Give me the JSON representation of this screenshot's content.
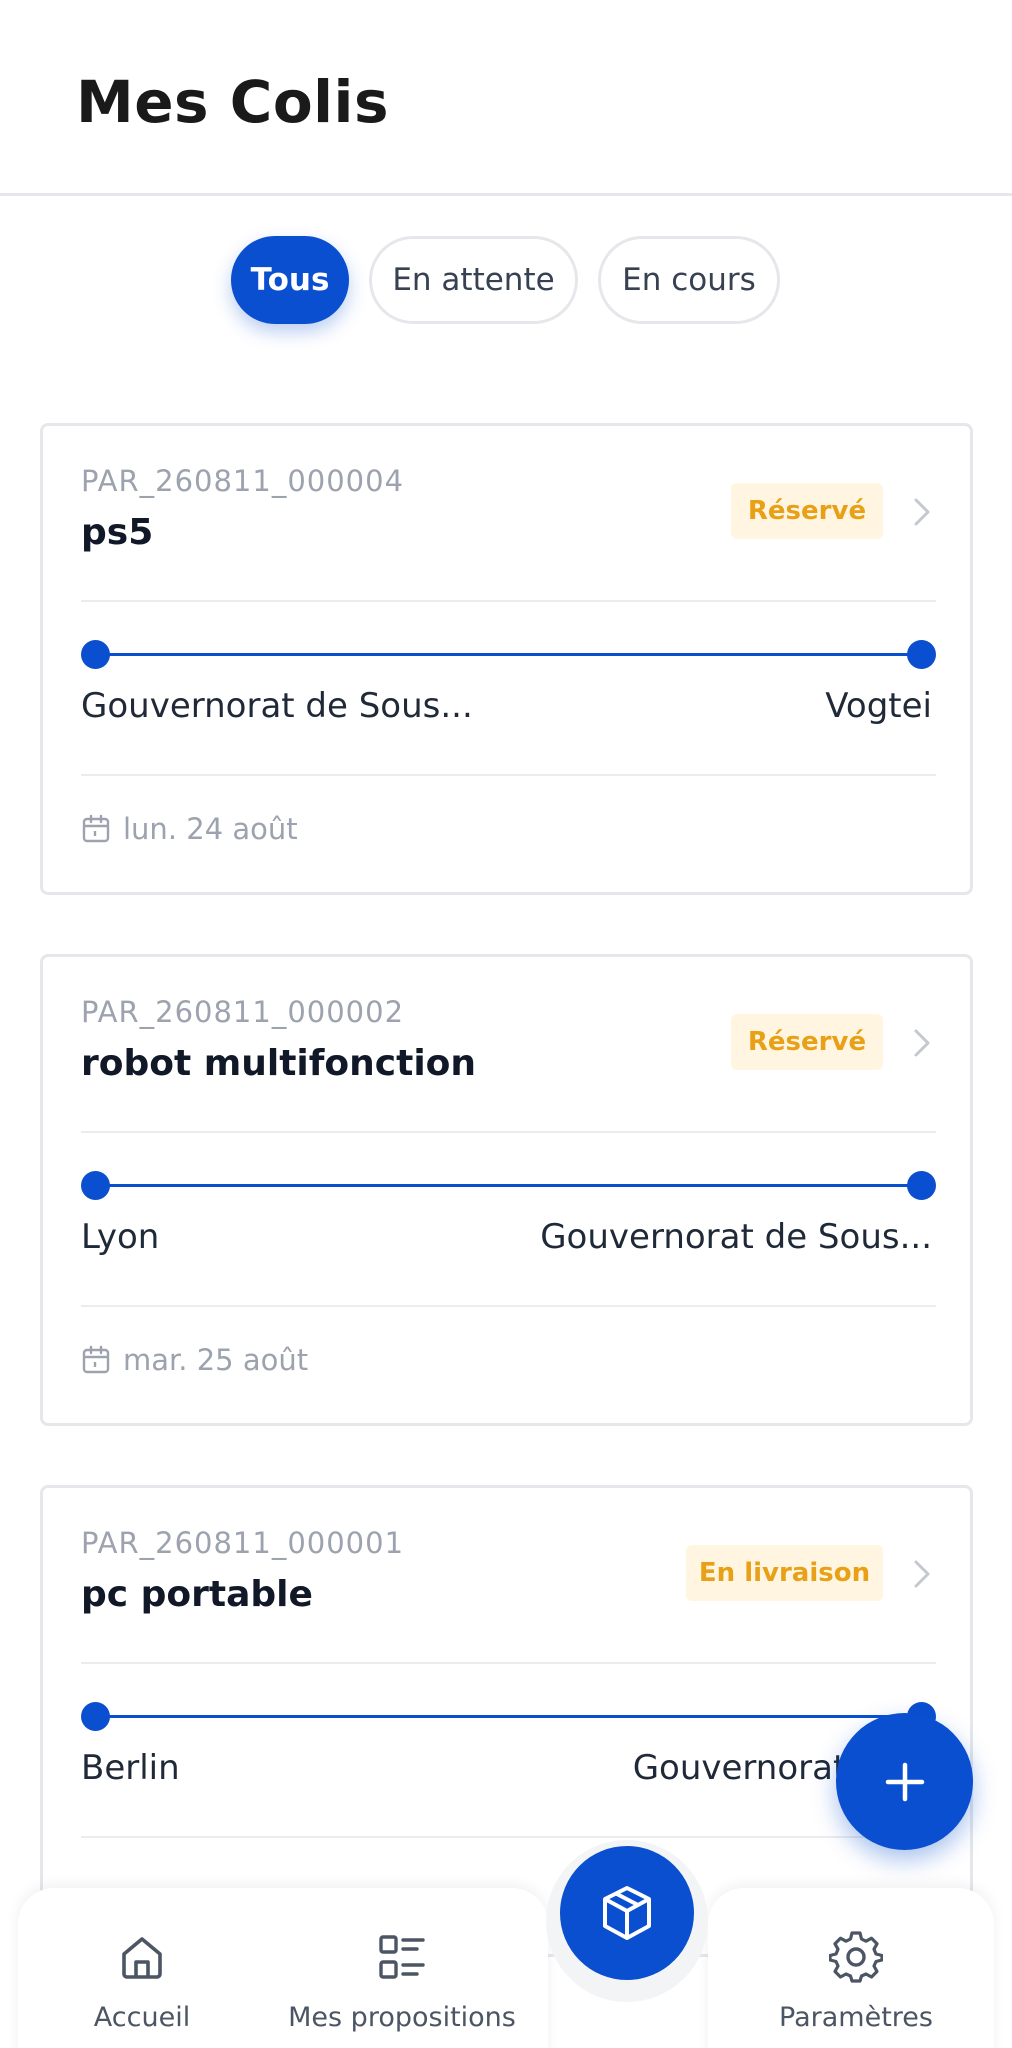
{
  "header": {
    "title": "Mes Colis"
  },
  "filters": [
    {
      "label": "Tous",
      "active": true
    },
    {
      "label": "En attente",
      "active": false
    },
    {
      "label": "En cours",
      "active": false
    }
  ],
  "parcels": [
    {
      "ref": "PAR_260811_000004",
      "name": "ps5",
      "status": "Réservé",
      "from": "Gouvernorat de Sous...",
      "to": "Vogtei",
      "date": "lun. 24 août"
    },
    {
      "ref": "PAR_260811_000002",
      "name": "robot multifonction",
      "status": "Réservé",
      "from": "Lyon",
      "to": "Gouvernorat de Sous...",
      "date": "mar. 25 août"
    },
    {
      "ref": "PAR_260811_000001",
      "name": "pc portable",
      "status": "En livraison",
      "from": "Berlin",
      "to": "Gouvernorat de S",
      "date": ""
    }
  ],
  "bottom_nav": {
    "home_label": "Accueil",
    "proposals_label": "Mes propositions",
    "settings_label": "Paramètres"
  },
  "icons": {
    "chevron": "chevron-right-icon",
    "calendar": "calendar-icon",
    "add": "plus-icon",
    "home": "home-icon",
    "list": "list-icon",
    "box": "box-icon",
    "settings": "gear-icon"
  },
  "colors": {
    "primary": "#0a4fcf",
    "badge_bg": "#fff5e0",
    "badge_text": "#e8a017",
    "muted": "#9ca3af"
  }
}
